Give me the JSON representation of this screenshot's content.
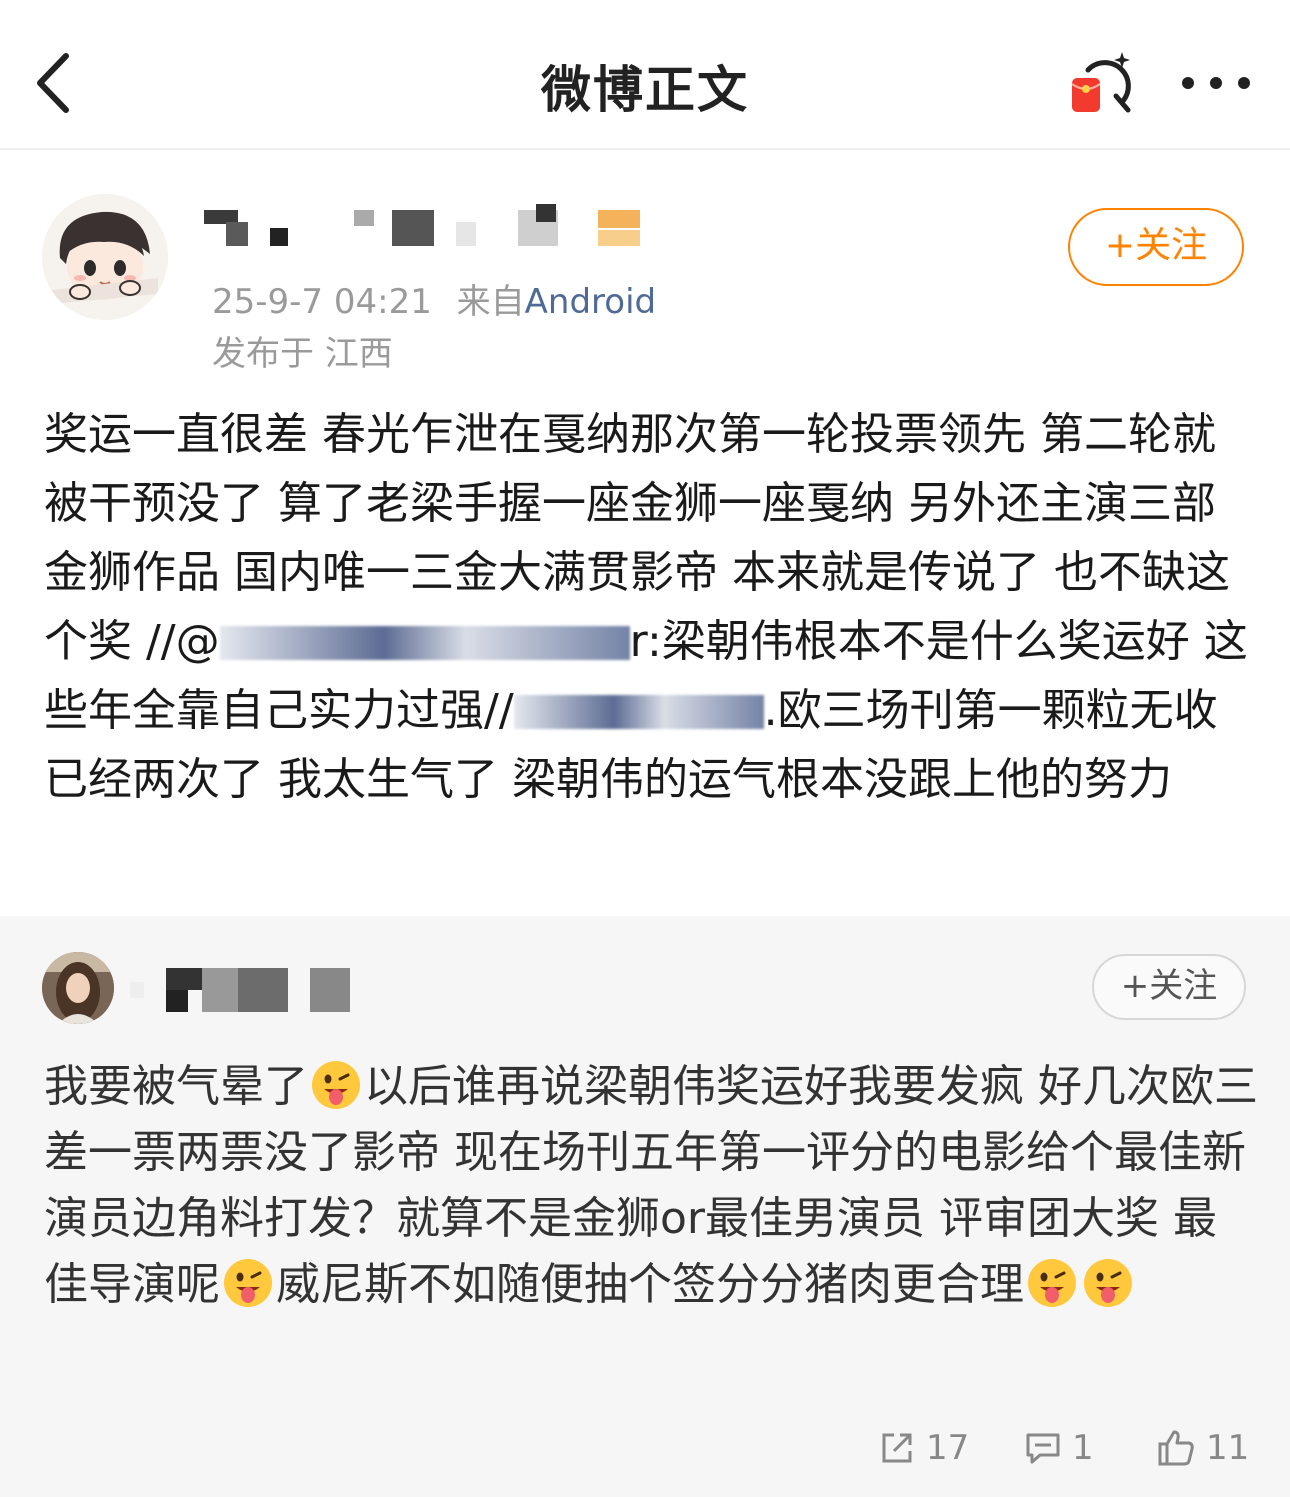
{
  "header": {
    "title": "微博正文",
    "back_icon": "chevron-left-icon",
    "redpacket_icon": "red-packet-icon",
    "more_icon": "more-dots-icon"
  },
  "post": {
    "time": "25-9-7 04:21",
    "from_label": "来自",
    "source": "Android",
    "location": "发布于 江西",
    "follow_label": "+关注",
    "text_parts": {
      "p1": "奖运一直很差 春光乍泄在戛纳那次第一轮投票领先 第二轮就被干预没了 算了老梁手握一座金狮一座戛纳 另外还主演三部金狮作品 国内唯一三金大满贯影帝 本来就是传说了 也不缺这个奖 //@",
      "p2": "r:梁朝伟根本不是什么奖运好 这些年全靠自己实力过强//",
      "p3": ".欧三场刊第一颗粒无收已经两次了 我太生气了 梁朝伟的运气根本没跟上他的努力"
    }
  },
  "repost": {
    "follow_label": "+关注",
    "text_parts": {
      "s1": "我要被气晕了",
      "s2": "以后谁再说梁朝伟奖运好我要发疯 好几次欧三差一票两票没了影帝 现在场刊五年第一评分的电影给个最佳新演员边角料打发？就算不是金狮or最佳男演员 评审团大奖 最佳导演呢",
      "s3": "威尼斯不如随便抽个签分分猪肉更合理"
    },
    "emoji_name": "tongue-out-emoji"
  },
  "actions": {
    "repost_count": "17",
    "comment_count": "1",
    "like_count": "11"
  },
  "colors": {
    "accent": "#ff8200",
    "link": "#4f6a96",
    "bg_repost": "#f6f6f6"
  }
}
